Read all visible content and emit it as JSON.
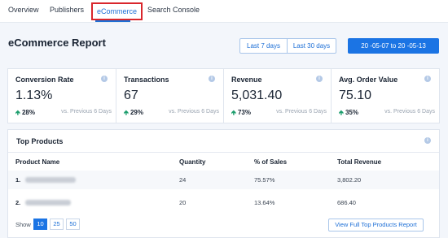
{
  "tabs": [
    {
      "label": "Overview"
    },
    {
      "label": "Publishers"
    },
    {
      "label": "eCommerce",
      "active": true
    },
    {
      "label": "Search Console"
    }
  ],
  "page": {
    "title": "eCommerce Report"
  },
  "date_filters": {
    "last7_label": "Last 7 days",
    "last30_label": "Last 30 days",
    "range_label": "20   -05-07 to 20   -05-13"
  },
  "stats": [
    {
      "label": "Conversion Rate",
      "value": "1.13%",
      "change": "28%",
      "compare": "vs. Previous 6 Days"
    },
    {
      "label": "Transactions",
      "value": "67",
      "change": "29%",
      "compare": "vs. Previous 6 Days"
    },
    {
      "label": "Revenue",
      "value": "5,031.40",
      "change": "73%",
      "compare": "vs. Previous 6 Days"
    },
    {
      "label": "Avg. Order Value",
      "value": "75.10",
      "change": "35%",
      "compare": "vs. Previous 6 Days"
    }
  ],
  "top_products": {
    "title": "Top Products",
    "columns": [
      "Product Name",
      "Quantity",
      "% of Sales",
      "Total Revenue"
    ],
    "rows": [
      {
        "index": "1.",
        "quantity": "24",
        "pct_sales": "75.57%",
        "revenue": "3,802.20"
      },
      {
        "index": "2.",
        "quantity": "20",
        "pct_sales": "13.64%",
        "revenue": "686.40"
      }
    ],
    "show_label": "Show",
    "page_sizes": [
      "10",
      "25",
      "50"
    ],
    "selected_page_size": "10",
    "view_full_label": "View Full Top Products Report"
  },
  "icons": {
    "info": "info-icon",
    "arrow_up": "arrow-up-icon"
  },
  "colors": {
    "accent": "#1b74e4",
    "positive": "#1e9e6e",
    "highlight_border": "#d9262c"
  }
}
